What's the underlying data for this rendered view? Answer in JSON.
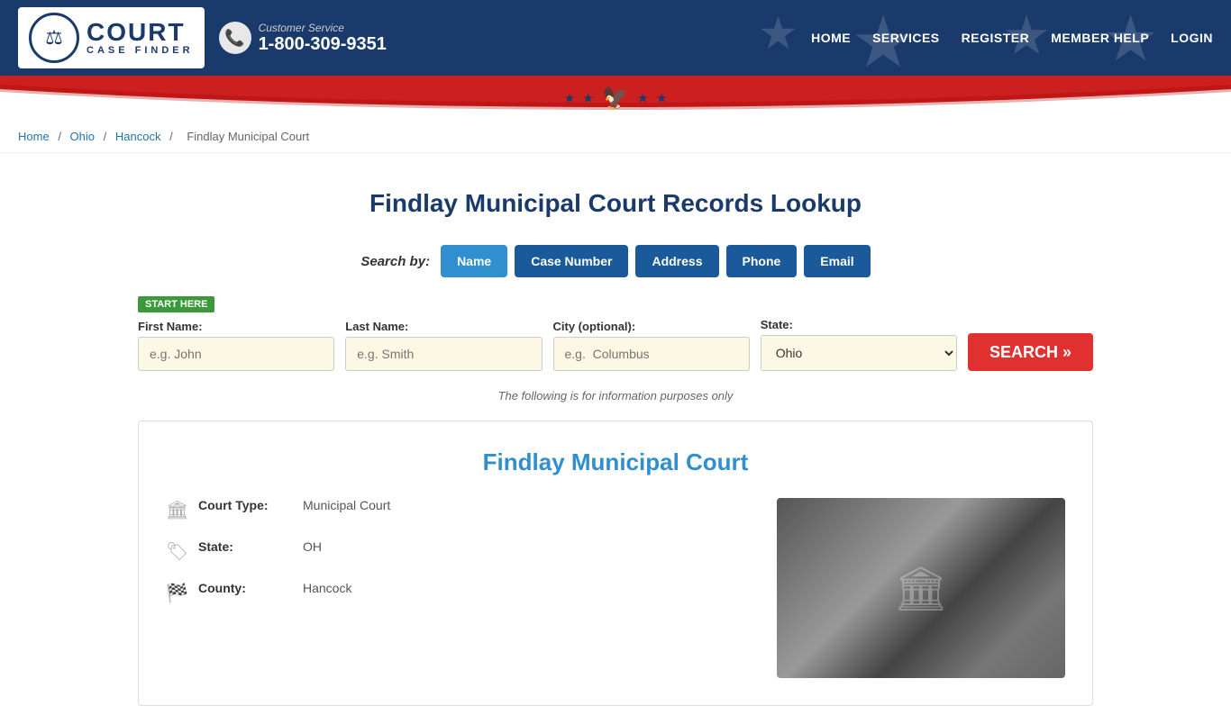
{
  "header": {
    "logo": {
      "court_text": "COURT",
      "case_finder_text": "CASE FINDER"
    },
    "customer_service_label": "Customer Service",
    "phone": "1-800-309-9351",
    "nav_items": [
      {
        "label": "HOME",
        "href": "#"
      },
      {
        "label": "SERVICES",
        "href": "#"
      },
      {
        "label": "REGISTER",
        "href": "#"
      },
      {
        "label": "MEMBER HELP",
        "href": "#"
      },
      {
        "label": "LOGIN",
        "href": "#"
      }
    ]
  },
  "breadcrumb": {
    "items": [
      {
        "label": "Home",
        "href": "#"
      },
      {
        "label": "Ohio",
        "href": "#"
      },
      {
        "label": "Hancock",
        "href": "#"
      },
      {
        "label": "Findlay Municipal Court",
        "href": null
      }
    ]
  },
  "page": {
    "title": "Findlay Municipal Court Records Lookup",
    "search_by_label": "Search by:",
    "search_tabs": [
      {
        "label": "Name",
        "active": true
      },
      {
        "label": "Case Number",
        "active": false
      },
      {
        "label": "Address",
        "active": false
      },
      {
        "label": "Phone",
        "active": false
      },
      {
        "label": "Email",
        "active": false
      }
    ],
    "start_here": "START HERE",
    "form": {
      "first_name_label": "First Name:",
      "first_name_placeholder": "e.g. John",
      "last_name_label": "Last Name:",
      "last_name_placeholder": "e.g. Smith",
      "city_label": "City (optional):",
      "city_placeholder": "e.g.  Columbus",
      "state_label": "State:",
      "state_value": "Ohio",
      "search_button": "SEARCH »"
    },
    "info_note": "The following is for information purposes only"
  },
  "court_card": {
    "title": "Findlay Municipal Court",
    "details": [
      {
        "icon": "🏛",
        "label": "Court Type:",
        "value": "Municipal Court"
      },
      {
        "icon": "🏷",
        "label": "State:",
        "value": "OH"
      },
      {
        "icon": "🏁",
        "label": "County:",
        "value": "Hancock"
      }
    ]
  }
}
